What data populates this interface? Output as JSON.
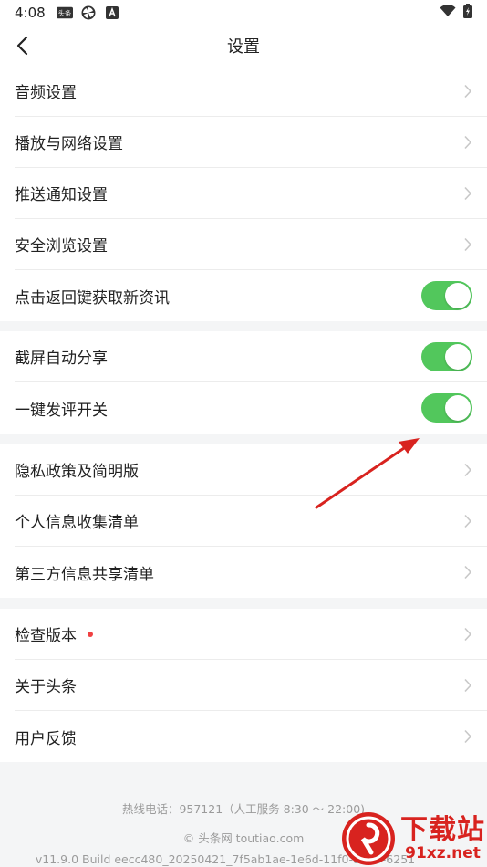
{
  "status": {
    "time": "4:08",
    "news_badge": "头条"
  },
  "nav": {
    "title": "设置"
  },
  "group1": [
    {
      "label": "音频设置",
      "control": "chevron"
    },
    {
      "label": "播放与网络设置",
      "control": "chevron"
    },
    {
      "label": "推送通知设置",
      "control": "chevron"
    },
    {
      "label": "安全浏览设置",
      "control": "chevron"
    },
    {
      "label": "点击返回键获取新资讯",
      "control": "toggle",
      "on": true
    }
  ],
  "group2": [
    {
      "label": "截屏自动分享",
      "control": "toggle",
      "on": true
    },
    {
      "label": "一键发评开关",
      "control": "toggle",
      "on": true
    }
  ],
  "group3": [
    {
      "label": "隐私政策及简明版",
      "control": "chevron"
    },
    {
      "label": "个人信息收集清单",
      "control": "chevron"
    },
    {
      "label": "第三方信息共享清单",
      "control": "chevron"
    }
  ],
  "group4": [
    {
      "label": "检查版本",
      "control": "chevron",
      "dot": true
    },
    {
      "label": "关于头条",
      "control": "chevron"
    },
    {
      "label": "用户反馈",
      "control": "chevron"
    }
  ],
  "footer": {
    "hotline": "热线电话：957121（人工服务 8:30 ～ 22:00)",
    "site": "© 头条网 toutiao.com",
    "build": "v11.9.0 Build eecc480_20250421_7f5ab1ae-1e6d-11f0-8930-6251"
  },
  "watermark": {
    "cn": "下载站",
    "en": "91xz.net"
  },
  "colors": {
    "toggle_on": "#52c75c",
    "dot": "#f04142",
    "arrow": "#d8231f"
  }
}
